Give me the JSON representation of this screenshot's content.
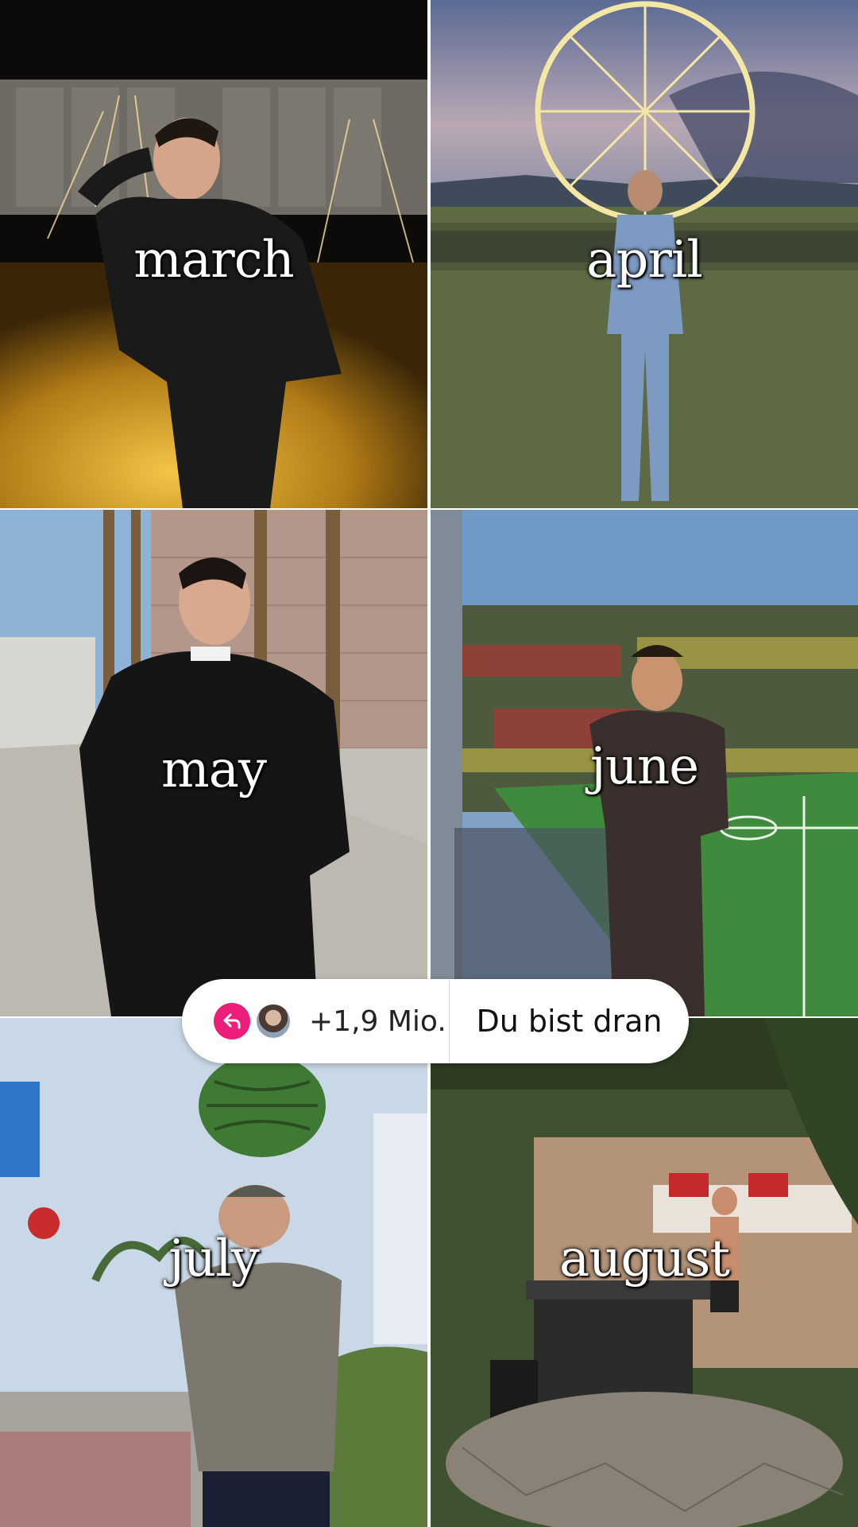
{
  "tiles": [
    {
      "id": "march",
      "label": "march"
    },
    {
      "id": "april",
      "label": "april"
    },
    {
      "id": "may",
      "label": "may"
    },
    {
      "id": "june",
      "label": "june"
    },
    {
      "id": "july",
      "label": "july"
    },
    {
      "id": "august",
      "label": "august"
    }
  ],
  "reply_bar": {
    "reply_icon": "reply-arrow-icon",
    "reply_count": "+1,9 Mio.",
    "cta_label": "Du bist dran"
  },
  "colors": {
    "reply_accent": "#ec1e79",
    "pill_background": "#ffffff"
  }
}
